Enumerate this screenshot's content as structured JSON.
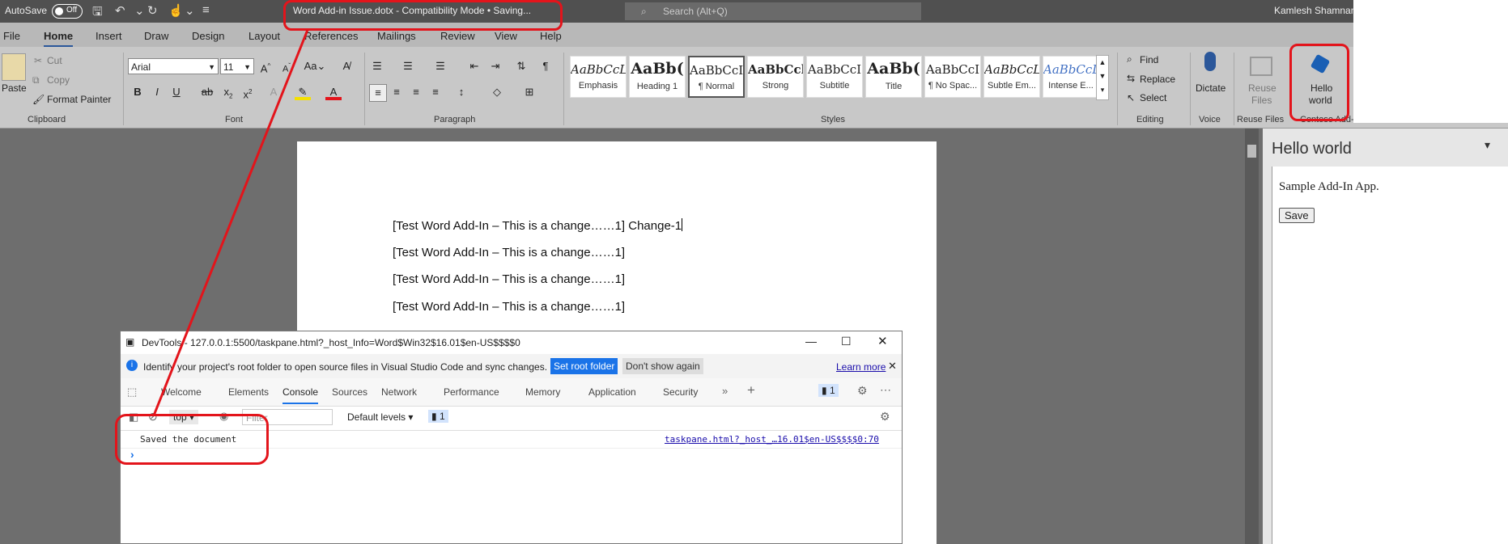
{
  "titlebar": {
    "autosave": "AutoSave",
    "autosave_state": "Off",
    "doc_title": "Word Add-in Issue.dotx  -  Compatibility Mode • Saving...",
    "search_placeholder": "Search (Alt+Q)",
    "user": "Kamlesh Shamnani"
  },
  "tabs": [
    "File",
    "Home",
    "Insert",
    "Draw",
    "Design",
    "Layout",
    "References",
    "Mailings",
    "Review",
    "View",
    "Help"
  ],
  "clipboard": {
    "paste": "Paste",
    "cut": "Cut",
    "copy": "Copy",
    "format_painter": "Format Painter",
    "group": "Clipboard"
  },
  "font": {
    "name": "Arial",
    "size": "11",
    "group": "Font",
    "case": "Aa"
  },
  "paragraph": {
    "group": "Paragraph"
  },
  "styles": {
    "group": "Styles",
    "items": [
      {
        "preview": "AaBbCcL",
        "name": "Emphasis"
      },
      {
        "preview": "AaBb(",
        "name": "Heading 1"
      },
      {
        "preview": "AaBbCcI",
        "name": "¶ Normal"
      },
      {
        "preview": "AaBbCcl",
        "name": "Strong"
      },
      {
        "preview": "AaBbCcI",
        "name": "Subtitle"
      },
      {
        "preview": "AaBb(",
        "name": "Title"
      },
      {
        "preview": "AaBbCcI",
        "name": "¶ No Spac..."
      },
      {
        "preview": "AaBbCcL",
        "name": "Subtle Em..."
      },
      {
        "preview": "AaBbCcL",
        "name": "Intense E..."
      }
    ]
  },
  "editing": {
    "find": "Find",
    "replace": "Replace",
    "select": "Select",
    "group": "Editing"
  },
  "voice": {
    "dictate": "Dictate",
    "group": "Voice"
  },
  "reuse": {
    "label_1": "Reuse",
    "label_2": "Files",
    "group": "Reuse Files"
  },
  "addin": {
    "label_1": "Hello",
    "label_2": "world",
    "group": "Contoso Add-in"
  },
  "document": {
    "paragraphs": [
      "[Test Word Add-In – This is a change……1] Change-1",
      "[Test Word Add-In – This is a change……1]",
      "[Test Word Add-In – This is a change……1]",
      "[Test Word Add-In – This is a change……1]"
    ]
  },
  "taskpane": {
    "title": "Hello world",
    "text": "Sample Add-In App.",
    "save": "Save"
  },
  "devtools": {
    "title": "DevTools - 127.0.0.1:5500/taskpane.html?_host_Info=Word$Win32$16.01$en-US$$$$0",
    "info": "Identify your project's root folder to open source files in Visual Studio Code and sync changes.",
    "set_root": "Set root folder",
    "dont_show": "Don't show again",
    "learn_more": "Learn more",
    "tabs": [
      "Welcome",
      "Elements",
      "Console",
      "Sources",
      "Network",
      "Performance",
      "Memory",
      "Application",
      "Security"
    ],
    "issues_count": "1",
    "context": "top",
    "filter_placeholder": "Filter",
    "levels": "Default levels",
    "log_message": "Saved the document",
    "log_source": "taskpane.html?_host_…16.01$en-US$$$$0:70",
    "prompt": "›"
  },
  "colors": {
    "accent": "#2b579a",
    "annotation": "#e3141b",
    "devtools_blue": "#1a73e8"
  }
}
